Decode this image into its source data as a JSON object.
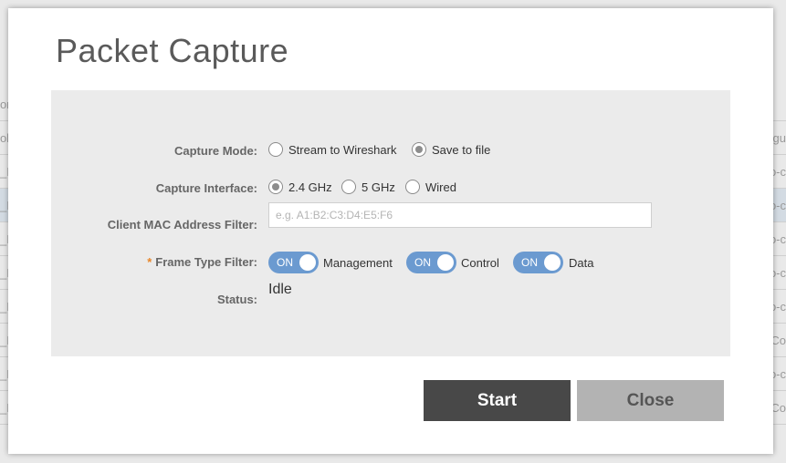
{
  "background_table": {
    "rows": [
      {
        "left": "on",
        "right": ""
      },
      {
        "left": "oli",
        "right": "gu"
      },
      {
        "left": "_I",
        "right": "o-c"
      },
      {
        "left": "_I",
        "right": "o-c"
      },
      {
        "left": "_I",
        "right": "o-c"
      },
      {
        "left": "_I",
        "right": "o-c"
      },
      {
        "left": "_I",
        "right": "o-c"
      },
      {
        "left": "_I",
        "right": "Co"
      },
      {
        "left": "_I",
        "right": "o-c"
      },
      {
        "left": "_I",
        "right": "Co"
      }
    ]
  },
  "dialog": {
    "title": "Packet Capture",
    "capture_mode": {
      "label": "Capture Mode:",
      "options": [
        "Stream to Wireshark",
        "Save to file"
      ],
      "selected": "Save to file"
    },
    "capture_interface": {
      "label": "Capture Interface:",
      "options": [
        "2.4 GHz",
        "5 GHz",
        "Wired"
      ],
      "selected": "2.4 GHz"
    },
    "client_mac": {
      "label": "Client MAC Address Filter:",
      "value": "",
      "placeholder": "e.g. A1:B2:C3:D4:E5:F6"
    },
    "frame_type": {
      "required_marker": "*",
      "label": "Frame Type Filter:",
      "toggles": [
        {
          "state": "ON",
          "label": "Management"
        },
        {
          "state": "ON",
          "label": "Control"
        },
        {
          "state": "ON",
          "label": "Data"
        }
      ]
    },
    "status": {
      "label": "Status:",
      "value": "Idle"
    },
    "buttons": {
      "start": "Start",
      "close": "Close"
    }
  },
  "colors": {
    "toggle_on": "#6b9ad0",
    "start_button": "#484848",
    "close_button": "#b3b3b3",
    "required_marker": "#e8862a",
    "panel": "#ebebeb"
  }
}
